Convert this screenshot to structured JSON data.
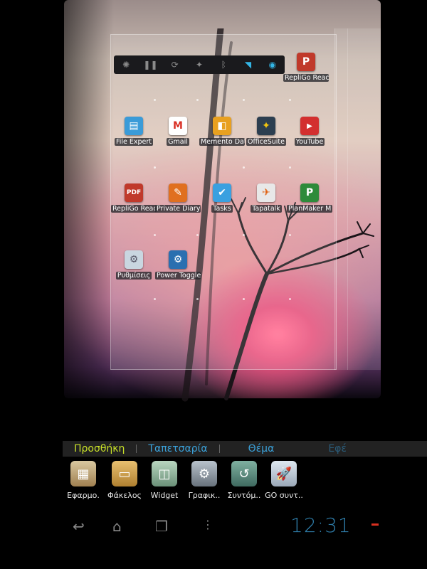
{
  "power_widget": {
    "icons": [
      "brightness-icon",
      "pause-icon",
      "sync-icon",
      "gps-icon",
      "bluetooth-icon",
      "wifi-icon",
      "location-icon"
    ],
    "active_icons": [
      "wifi-icon",
      "location-icon"
    ]
  },
  "home_apps": [
    {
      "label": "RepliGo Reac",
      "icon": "pdf-reader-icon",
      "color": "#c0392b"
    },
    {
      "label": "File Expert",
      "icon": "file-manager-icon",
      "color": "#3a9bd8"
    },
    {
      "label": "Gmail",
      "icon": "gmail-icon",
      "color": "#ffffff"
    },
    {
      "label": "Memento Dat",
      "icon": "database-icon",
      "color": "#e8a020"
    },
    {
      "label": "OfficeSuite",
      "icon": "office-icon",
      "color": "#2c3e50"
    },
    {
      "label": "YouTube",
      "icon": "youtube-icon",
      "color": "#d32f2f"
    },
    {
      "label": "RepliGo Read",
      "icon": "pdf-reader-icon",
      "color": "#c0392b"
    },
    {
      "label": "Private Diary",
      "icon": "diary-icon",
      "color": "#e07020"
    },
    {
      "label": "Tasks",
      "icon": "tasks-icon",
      "color": "#3aa0e0"
    },
    {
      "label": "Tapatalk",
      "icon": "forum-icon",
      "color": "#e8e8e8"
    },
    {
      "label": "PlanMaker M",
      "icon": "spreadsheet-icon",
      "color": "#2e8b3a"
    },
    {
      "label": "Ρυθμίσεις",
      "icon": "settings-icon",
      "color": "#c9d6e0"
    },
    {
      "label": "Power Toggle",
      "icon": "gear-icon",
      "color": "#2a6fb0"
    }
  ],
  "tabs": [
    "Προσθήκη",
    "Ταπετσαρία",
    "Θέμα",
    "Εφέ"
  ],
  "active_tab": "Προσθήκη",
  "add_items": [
    {
      "label": "Εφαρμο.",
      "icon": "apps-box-icon"
    },
    {
      "label": "Φάκελος",
      "icon": "folder-icon"
    },
    {
      "label": "Widget",
      "icon": "widget-icon"
    },
    {
      "label": "Γραφικ..",
      "icon": "graphics-gear-icon"
    },
    {
      "label": "Συντόμ..",
      "icon": "shortcut-icon"
    },
    {
      "label": "GO συντ..",
      "icon": "rocket-icon"
    }
  ],
  "clock": "12:31",
  "colors": {
    "accent_blue": "#33b5e5",
    "active_tab": "#c8e028",
    "clock": "#2e7ca8"
  }
}
